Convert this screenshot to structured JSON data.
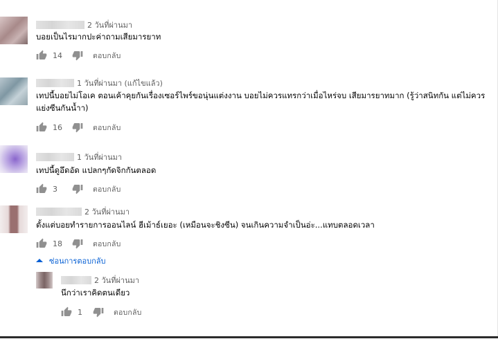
{
  "comments": [
    {
      "time": "2 วันที่ผ่านมา",
      "text": "บอยเป็นไรมากปะค่าถามเสียมารยาท",
      "likes": "14",
      "reply_label": "ตอบกลับ",
      "avatar_colors": [
        "#d9c6c6",
        "#a88a8a",
        "#c9b3b3",
        "#7e6868"
      ]
    },
    {
      "time": "1 วันที่ผ่านมา (แก้ไขแล้ว)",
      "text": "เทปนี้บอยไม่โอเค ตอนเค้าคุยกันเรื่องเซอร์ไพร์ขอนุ่นแต่งงาน บอยไม่ควรแทรกว่าเมื่อไหร่จบ เสียมารยาทมาก (รู้ว่าสนิทกัน แต่ไม่ควรแย่งซีนกันน้ำา)",
      "likes": "16",
      "reply_label": "ตอบกลับ",
      "avatar_colors": [
        "#b9c7cf",
        "#7f97a3",
        "#c5d2d8",
        "#93a5ad"
      ]
    },
    {
      "time": "1 วันที่ผ่านมา",
      "text": "เทปนี้ดูอึดอัด แปลกๆกัดจิกกันตลอด",
      "likes": "3",
      "reply_label": "ตอบกลับ",
      "avatar_colors": [
        "#c7b6e6",
        "#8a66cc",
        "#b49de0",
        "#e0d8f0"
      ]
    },
    {
      "time": "2 วันที่ผ่านมา",
      "text": "ตั้งแต่บอยทำรายการออนไลน์ ฮีเม้าธ์เยอะ (เหมือนจะชิงซีน) จนเกินความจำเป็นอ่ะ...แทบตลอดเวลา",
      "likes": "18",
      "reply_label": "ตอบกลับ",
      "avatar_colors": [
        "#e6d9d9",
        "#9a7070",
        "#b89191",
        "#ffffff"
      ]
    }
  ],
  "hide_replies_label": "ซ่อนการตอบกลับ",
  "reply": {
    "time": "2 วันที่ผ่านมา",
    "text": "นึกว่าเราคิดตนเดียว",
    "likes": "1",
    "reply_label": "ตอบกลับ",
    "avatar_colors": [
      "#b3a5a5",
      "#7a6464",
      "#9e8b8b",
      "#d4c9c9"
    ]
  },
  "colors": {
    "link_blue": "#065fd4",
    "icon_gray": "#909090",
    "meta_gray": "#606060"
  },
  "icons": [
    "thumb-up-icon",
    "thumb-down-icon",
    "caret-up-icon"
  ]
}
